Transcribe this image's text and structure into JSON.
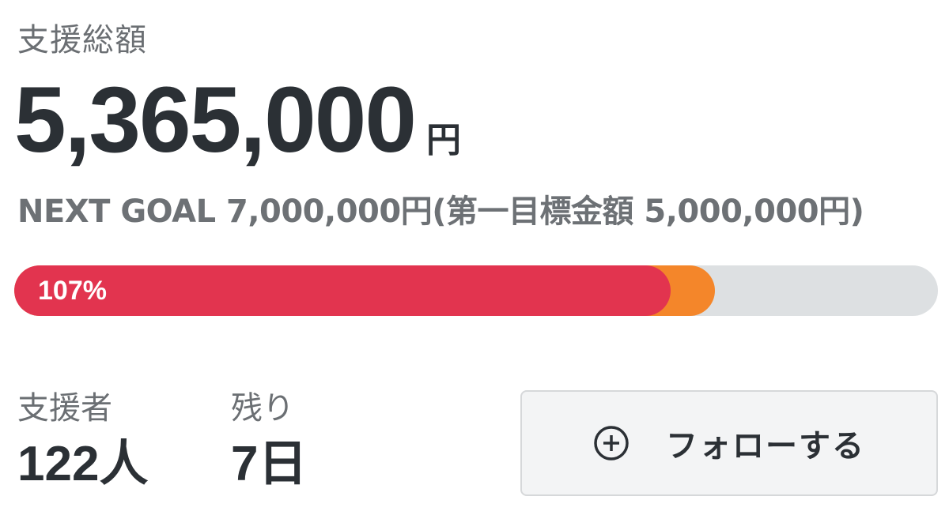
{
  "funding": {
    "label": "支援総額",
    "amount": "5,365,000",
    "unit": "円",
    "goal_text": "NEXT GOAL 7,000,000円(第一目標金額 5,000,000円)",
    "progress_text": "107%",
    "progress_percent": 107
  },
  "stats": {
    "supporters_label": "支援者",
    "supporters_value": "122人",
    "remaining_label": "残り",
    "remaining_value": "7日"
  },
  "follow": {
    "label": "フォローする",
    "icon": "plus-circle-icon"
  },
  "colors": {
    "progress_main": "#e2344f",
    "progress_next": "#f4862a",
    "progress_track": "#dde0e2"
  }
}
